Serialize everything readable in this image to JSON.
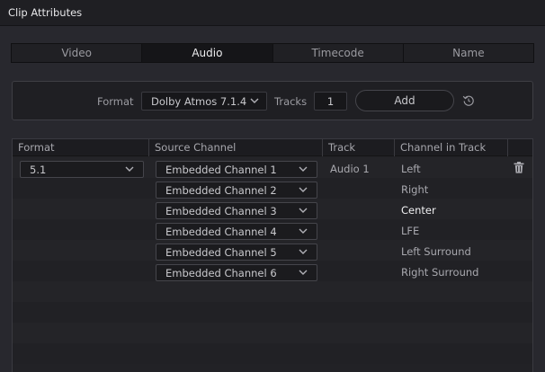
{
  "window": {
    "title": "Clip Attributes"
  },
  "tabs": [
    {
      "label": "Video",
      "active": false
    },
    {
      "label": "Audio",
      "active": true
    },
    {
      "label": "Timecode",
      "active": false
    },
    {
      "label": "Name",
      "active": false
    }
  ],
  "format_panel": {
    "format_label": "Format",
    "format_value": "Dolby Atmos 7.1.4",
    "tracks_label": "Tracks",
    "tracks_value": "1",
    "add_label": "Add",
    "reset_icon": "reset-icon"
  },
  "table": {
    "headers": [
      "Format",
      "Source Channel",
      "Track",
      "Channel in Track"
    ],
    "format_value": "5.1",
    "track_value": "Audio 1",
    "rows": [
      {
        "source": "Embedded Channel 1",
        "channel": "Left",
        "highlight": false
      },
      {
        "source": "Embedded Channel 2",
        "channel": "Right",
        "highlight": false
      },
      {
        "source": "Embedded Channel 3",
        "channel": "Center",
        "highlight": true
      },
      {
        "source": "Embedded Channel 4",
        "channel": "LFE",
        "highlight": false
      },
      {
        "source": "Embedded Channel 5",
        "channel": "Left Surround",
        "highlight": false
      },
      {
        "source": "Embedded Channel 6",
        "channel": "Right Surround",
        "highlight": false
      }
    ],
    "delete_icon": "trash-icon"
  }
}
